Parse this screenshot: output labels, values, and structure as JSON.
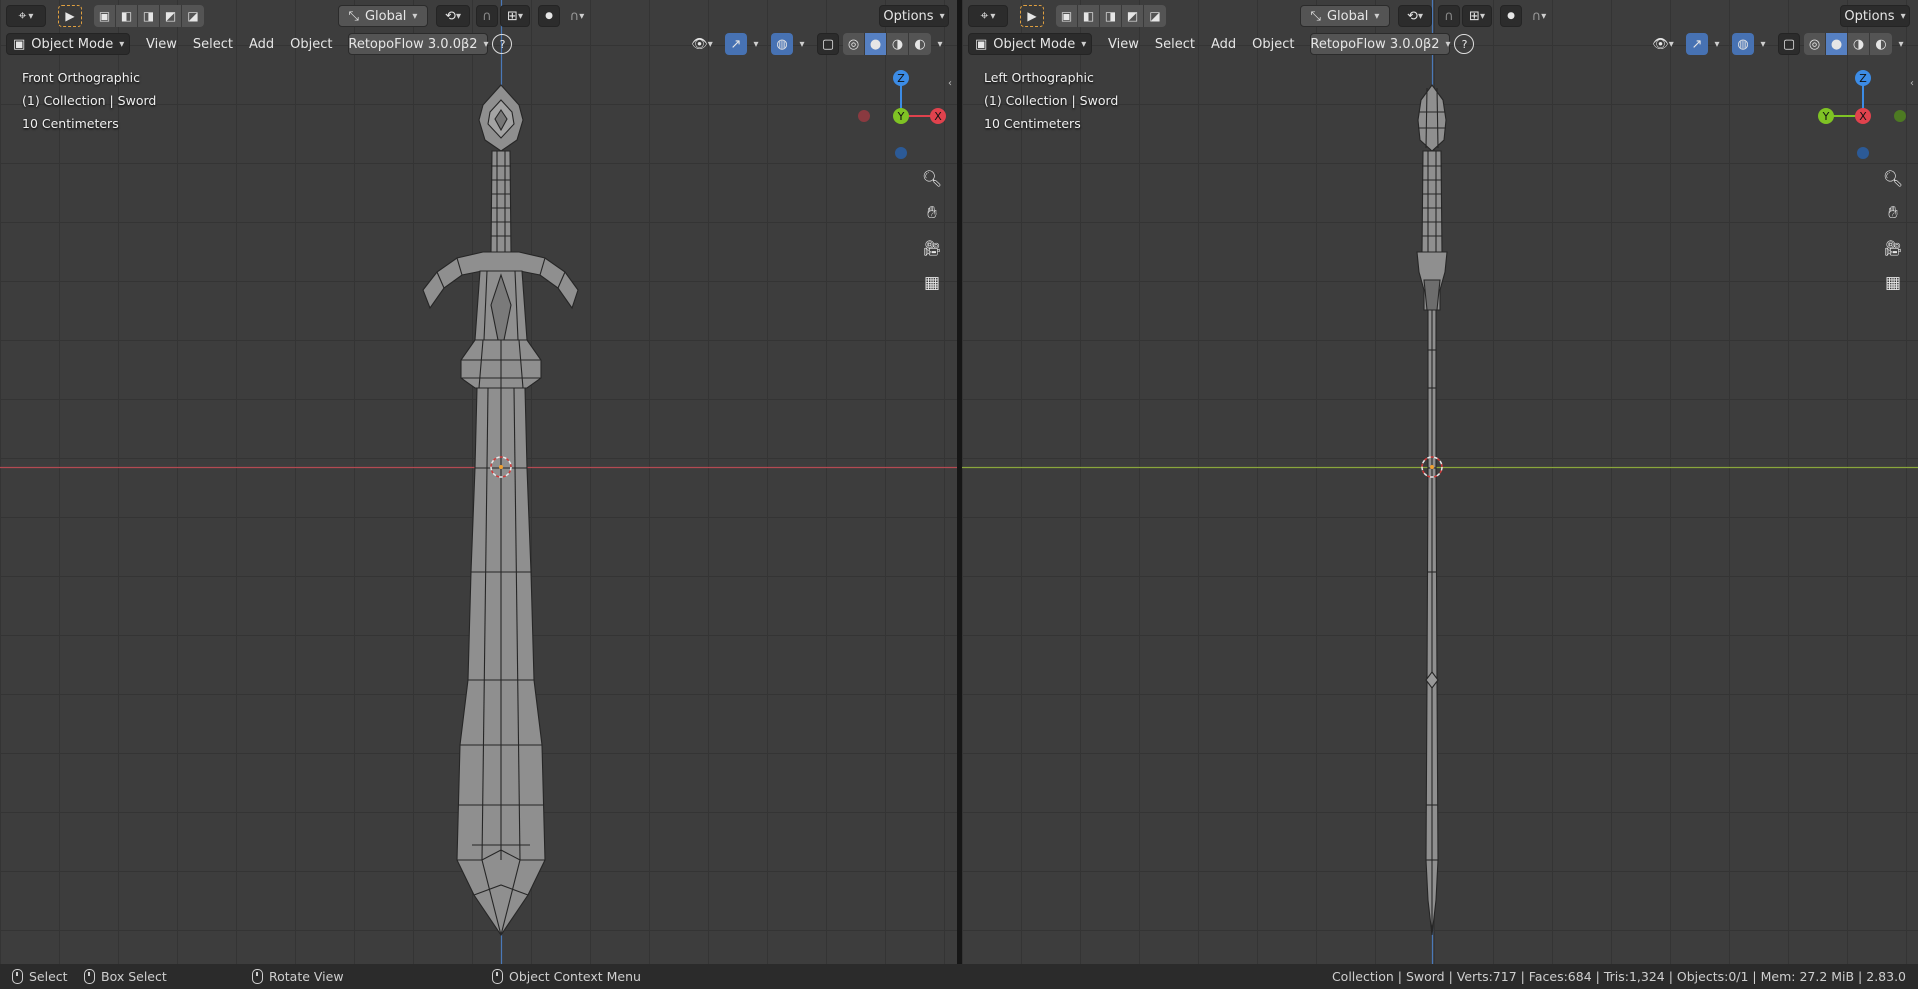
{
  "header": {
    "transform_orientation": "Global",
    "options_label": "Options",
    "mode_label": "Object Mode",
    "menu": [
      "View",
      "Select",
      "Add",
      "Object"
    ],
    "addon_label": "RetopoFlow 3.0.0β2",
    "help_glyph": "?"
  },
  "viewports": [
    {
      "view_name": "Front Orthographic",
      "collection": "(1) Collection | Sword",
      "scale": "10 Centimeters",
      "gizmo": {
        "top": "Z",
        "right": "X",
        "center": "Y"
      }
    },
    {
      "view_name": "Left Orthographic",
      "collection": "(1) Collection | Sword",
      "scale": "10 Centimeters",
      "gizmo": {
        "top": "Z",
        "right": "X",
        "center": "Y"
      }
    }
  ],
  "statusbar": {
    "select": "Select",
    "box_select": "Box Select",
    "rotate_view": "Rotate View",
    "context_menu": "Object Context Menu",
    "stats": "Collection | Sword | Verts:717 | Faces:684 | Tris:1,324 | Objects:0/1 | Mem: 27.2 MiB | 2.83.0"
  },
  "colors": {
    "axis_x": "#e0424d",
    "axis_y": "#7fc324",
    "axis_z": "#3c8ce6",
    "active_button": "#4772b3"
  },
  "icons": [
    "editor-type-icon",
    "select-tool-icon",
    "select-mode-icons",
    "transform-orientation-icon",
    "pivot-icon",
    "snap-icon",
    "proportional-icon",
    "visibility-icon",
    "gizmo-icon",
    "overlay-icon",
    "xray-icon",
    "shading-icons",
    "zoom-icon",
    "hand-icon",
    "camera-icon",
    "grid-icon"
  ]
}
